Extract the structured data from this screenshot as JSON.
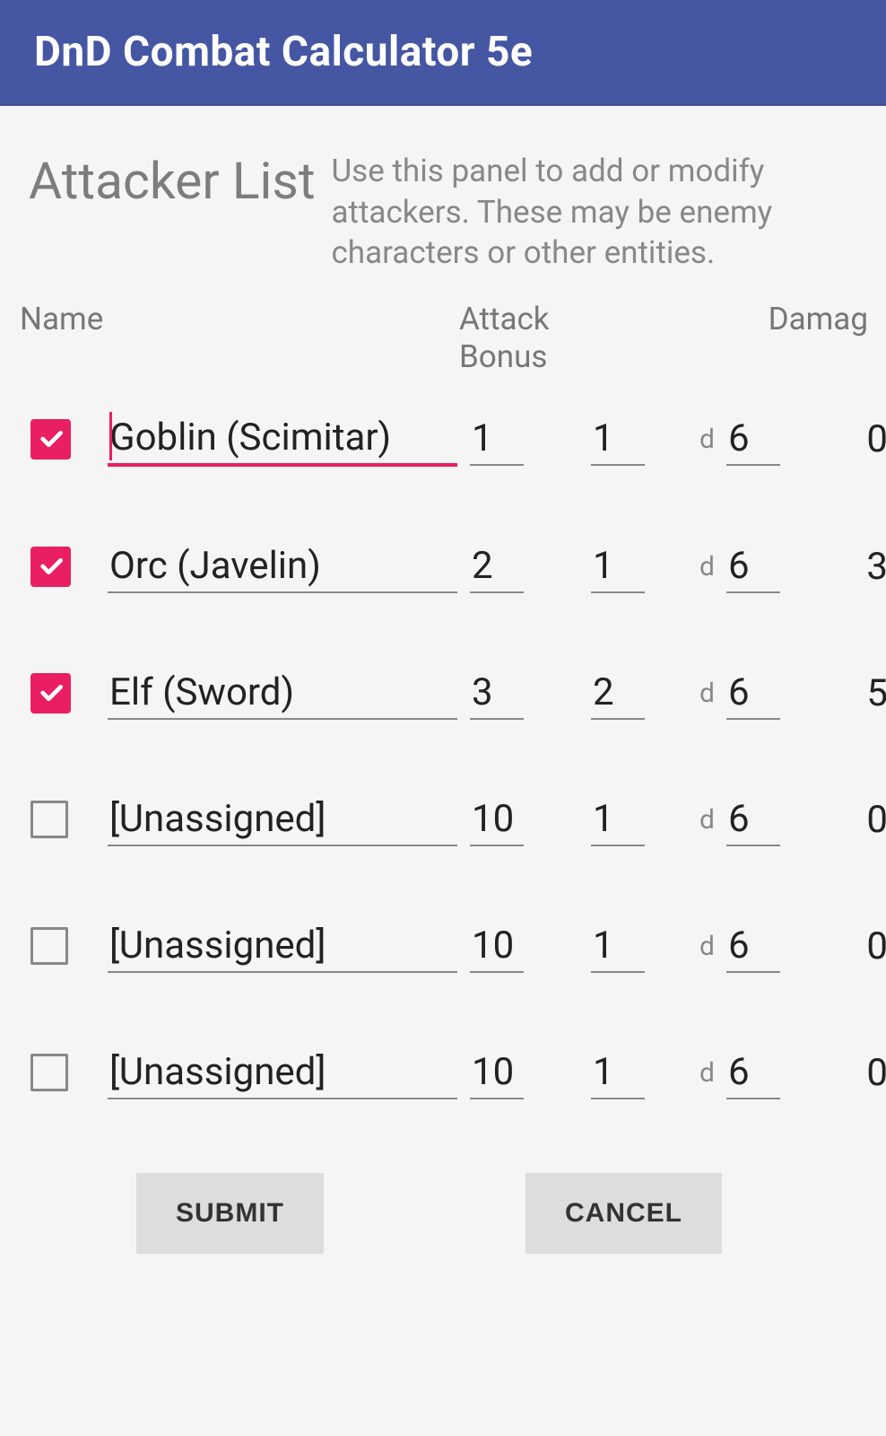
{
  "header": {
    "title": "DnD Combat Calculator 5e"
  },
  "section": {
    "title": "Attacker List",
    "description": "Use this panel to add or modify attackers. These may be enemy characters or other entities."
  },
  "columns": {
    "name": "Name",
    "attack_bonus": "Attack\nBonus",
    "damage": "Damag"
  },
  "rows": [
    {
      "checked": true,
      "active": true,
      "name": "Goblin (Scimitar)",
      "attack_bonus": "1",
      "dice_count": "1",
      "d": "d",
      "die_type": "6",
      "trailing": "0"
    },
    {
      "checked": true,
      "active": false,
      "name": "Orc (Javelin)",
      "attack_bonus": "2",
      "dice_count": "1",
      "d": "d",
      "die_type": "6",
      "trailing": "3"
    },
    {
      "checked": true,
      "active": false,
      "name": "Elf (Sword)",
      "attack_bonus": "3",
      "dice_count": "2",
      "d": "d",
      "die_type": "6",
      "trailing": "5"
    },
    {
      "checked": false,
      "active": false,
      "name": "[Unassigned]",
      "attack_bonus": "10",
      "dice_count": "1",
      "d": "d",
      "die_type": "6",
      "trailing": "0"
    },
    {
      "checked": false,
      "active": false,
      "name": "[Unassigned]",
      "attack_bonus": "10",
      "dice_count": "1",
      "d": "d",
      "die_type": "6",
      "trailing": "0"
    },
    {
      "checked": false,
      "active": false,
      "name": "[Unassigned]",
      "attack_bonus": "10",
      "dice_count": "1",
      "d": "d",
      "die_type": "6",
      "trailing": "0"
    }
  ],
  "buttons": {
    "submit": "SUBMIT",
    "cancel": "CANCEL"
  }
}
